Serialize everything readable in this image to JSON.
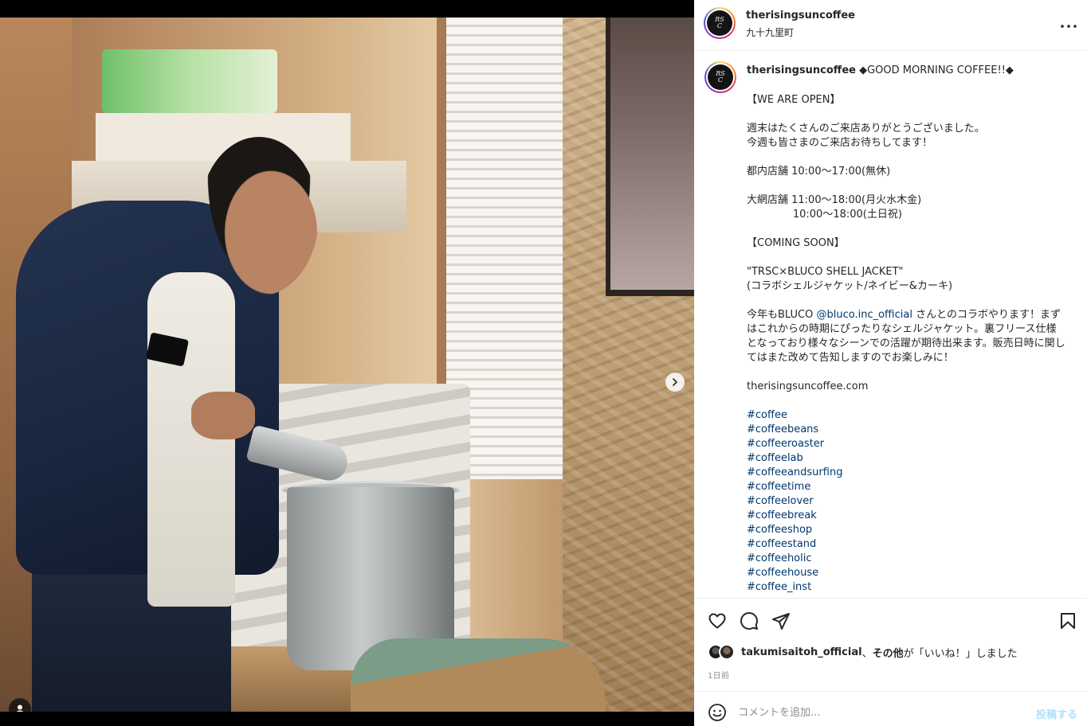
{
  "post": {
    "username": "therisingsuncoffee",
    "location": "九十九里町",
    "avatar_logo_text": "Rising Sun Coffee",
    "more_icon": "more-horizontal-icon"
  },
  "caption": {
    "username": "therisingsuncoffee",
    "first_line": "◆GOOD MORNING COFFEE!!◆",
    "lines": [
      "",
      "【WE ARE OPEN】",
      "",
      "週末はたくさんのご来店ありがとうございました。",
      "今週も皆さまのご来店お待ちしてます！",
      "",
      "都内店舗 10:00～17:00(無休)",
      "",
      "大網店舗 11:00～18:00(月火水木金)",
      "              10:00～18:00(土日祝)",
      "",
      "【COMING SOON】",
      "",
      "\"TRSC×BLUCO SHELL JACKET\"",
      "(コラボシェルジャケット/ネイビー&カーキ)",
      ""
    ],
    "para_prefix": "今年もBLUCO ",
    "mention": "@bluco.inc_official",
    "para_suffix": " さんとのコラボやります！まずはこれからの時期にぴったりなシェルジャケット。裏フリース仕様となっており様々なシーンでの活躍が期待出来ます。販売日時に関してはまた改めて告知しますのでお楽しみに！",
    "website": "therisingsuncoffee.com",
    "hashtags": [
      "#coffee",
      "#coffeebeans",
      "#coffeeroaster",
      "#coffeelab",
      "#coffeeandsurfing",
      "#coffeetime",
      "#coffeelover",
      "#coffeebreak",
      "#coffeeshop",
      "#coffeestand",
      "#coffeeholic",
      "#coffeehouse",
      "#coffee_inst"
    ]
  },
  "likes": {
    "user": "takumisaitoh_official",
    "separator": "、",
    "others": "その他",
    "suffix": "が「いいね！」しました"
  },
  "time_ago": "1日前",
  "comment": {
    "placeholder": "コメントを追加...",
    "post_label": "投稿する"
  },
  "carousel": {
    "slide_count": 2,
    "current": 1
  },
  "colors": {
    "link": "#00376b",
    "post_button_disabled": "#b2dffc",
    "muted": "#8e8e8e"
  }
}
